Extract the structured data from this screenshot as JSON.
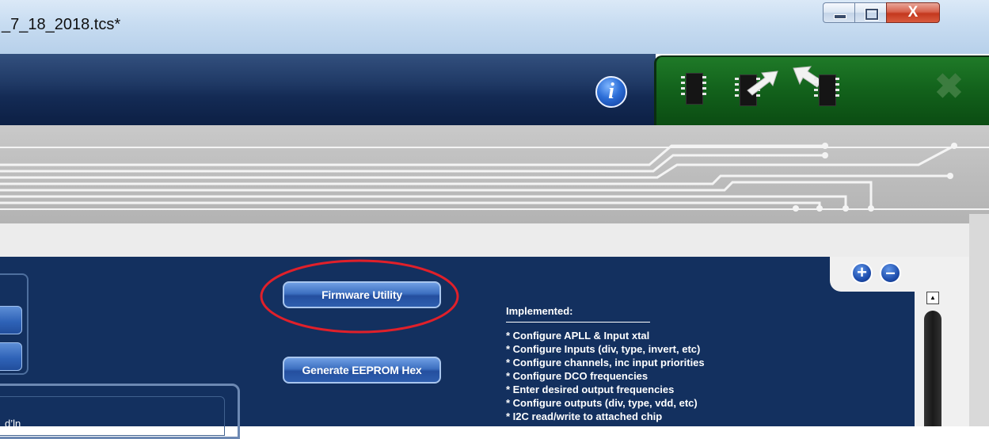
{
  "window": {
    "title": "_7_18_2018.tcs*",
    "minimize_icon": "minimize-icon",
    "maximize_icon": "maximize-icon",
    "close_glyph": "X"
  },
  "header": {
    "info_glyph": "i",
    "toolbar_icons": [
      "chip-icon",
      "chip-read-icon",
      "chip-write-icon",
      "close-icon"
    ],
    "close_glyph": "✖",
    "colors": {
      "header_blue": "#142b55",
      "toolbar_green": "#12611b"
    }
  },
  "main": {
    "zoom_in": "+",
    "zoom_out": "–",
    "firmware_button": "Firmware Utility",
    "eeprom_button": "Generate EEPROM Hex",
    "bottom_fragment": "d’ln",
    "scroll_up_glyph": "▲",
    "notes": {
      "heading": "Implemented:",
      "items": [
        "* Configure APLL & Input xtal",
        "* Configure Inputs (div, type, invert, etc)",
        "* Configure channels, inc input priorities",
        "* Configure DCO frequencies",
        "* Enter desired output frequencies",
        "* Configure outputs (div, type, vdd, etc)",
        "* I2C read/write to attached chip"
      ]
    },
    "highlight_color": "#e0202a"
  }
}
